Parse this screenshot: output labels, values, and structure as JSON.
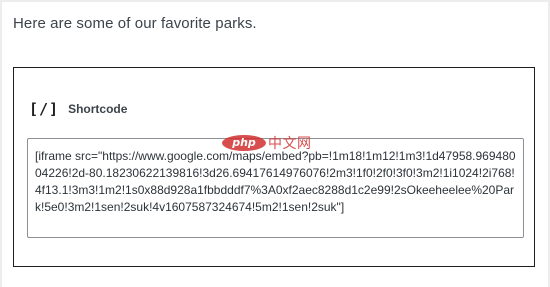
{
  "intro": {
    "text": "Here are some of our favorite parks."
  },
  "shortcode_block": {
    "icon_glyph": "[/]",
    "title": "Shortcode",
    "value": "[iframe src=\"https://www.google.com/maps/embed?pb=!1m18!1m12!1m3!1d47958.96948004226!2d-80.18230622139816!3d26.69417614976076!2m3!1f0!2f0!3f0!3m2!1i1024!2i768!4f13.1!3m3!1m2!1s0x88d928a1fbbdddf7%3A0xf2aec8288d1c2e99!2sOkeeheelee%20Park!5e0!3m2!1sen!2suk!4v1607587324674!5m2!1sen!2suk\"]"
  },
  "watermark": {
    "logo": "php",
    "text": "中文网",
    "color": "#d22f2f"
  }
}
